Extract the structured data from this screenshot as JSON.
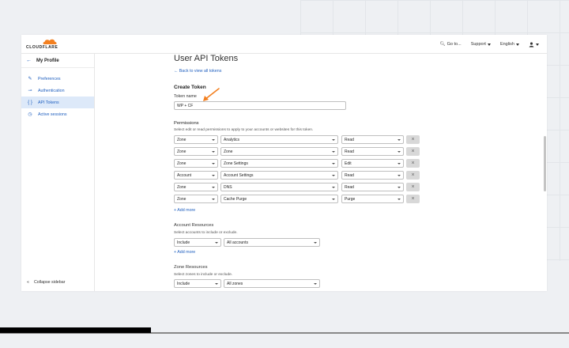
{
  "brand": {
    "logo_text": "CLOUDFLARE",
    "accent": "#f38020",
    "link_color": "#1f5fbf"
  },
  "topnav": {
    "goto": "Go to...",
    "support": "Support",
    "language": "English"
  },
  "sidebar": {
    "title": "My Profile",
    "items": [
      {
        "label": "Preferences",
        "icon": "pencil-icon"
      },
      {
        "label": "Authentication",
        "icon": "key-icon"
      },
      {
        "label": "API Tokens",
        "icon": "braces-icon",
        "active": true
      },
      {
        "label": "Active sessions",
        "icon": "clock-icon"
      }
    ],
    "collapse": "Collapse sidebar"
  },
  "main": {
    "title": "User API Tokens",
    "back_link": "← Back to view all tokens",
    "create_title": "Create Token",
    "token_name_label": "Token name",
    "token_name_value": "WP + CF",
    "permissions": {
      "title": "Permissions",
      "help": "Select edit or read permissions to apply to your accounts or websites for this token.",
      "rows": [
        {
          "scope": "Zone",
          "resource": "Analytics",
          "access": "Read"
        },
        {
          "scope": "Zone",
          "resource": "Zone",
          "access": "Read"
        },
        {
          "scope": "Zone",
          "resource": "Zone Settings",
          "access": "Edit"
        },
        {
          "scope": "Account",
          "resource": "Account Settings",
          "access": "Read"
        },
        {
          "scope": "Zone",
          "resource": "DNS",
          "access": "Read"
        },
        {
          "scope": "Zone",
          "resource": "Cache Purge",
          "access": "Purge"
        }
      ],
      "add_more": "+ Add more"
    },
    "account_resources": {
      "title": "Account Resources",
      "help": "Select accounts to include or exclude.",
      "mode": "Include",
      "value": "All accounts",
      "add_more": "+ Add more"
    },
    "zone_resources": {
      "title": "Zone Resources",
      "help": "Select zones to include or exclude.",
      "mode": "Include",
      "value": "All zones"
    }
  },
  "video_progress": 0.265
}
